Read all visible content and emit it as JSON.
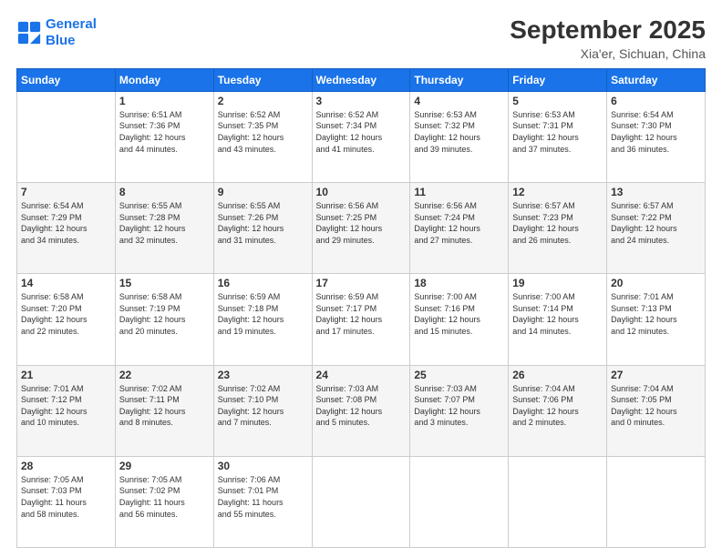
{
  "logo": {
    "line1": "General",
    "line2": "Blue"
  },
  "title": "September 2025",
  "subtitle": "Xia'er, Sichuan, China",
  "days_of_week": [
    "Sunday",
    "Monday",
    "Tuesday",
    "Wednesday",
    "Thursday",
    "Friday",
    "Saturday"
  ],
  "weeks": [
    [
      {
        "day": "",
        "info": ""
      },
      {
        "day": "1",
        "info": "Sunrise: 6:51 AM\nSunset: 7:36 PM\nDaylight: 12 hours\nand 44 minutes."
      },
      {
        "day": "2",
        "info": "Sunrise: 6:52 AM\nSunset: 7:35 PM\nDaylight: 12 hours\nand 43 minutes."
      },
      {
        "day": "3",
        "info": "Sunrise: 6:52 AM\nSunset: 7:34 PM\nDaylight: 12 hours\nand 41 minutes."
      },
      {
        "day": "4",
        "info": "Sunrise: 6:53 AM\nSunset: 7:32 PM\nDaylight: 12 hours\nand 39 minutes."
      },
      {
        "day": "5",
        "info": "Sunrise: 6:53 AM\nSunset: 7:31 PM\nDaylight: 12 hours\nand 37 minutes."
      },
      {
        "day": "6",
        "info": "Sunrise: 6:54 AM\nSunset: 7:30 PM\nDaylight: 12 hours\nand 36 minutes."
      }
    ],
    [
      {
        "day": "7",
        "info": "Sunrise: 6:54 AM\nSunset: 7:29 PM\nDaylight: 12 hours\nand 34 minutes."
      },
      {
        "day": "8",
        "info": "Sunrise: 6:55 AM\nSunset: 7:28 PM\nDaylight: 12 hours\nand 32 minutes."
      },
      {
        "day": "9",
        "info": "Sunrise: 6:55 AM\nSunset: 7:26 PM\nDaylight: 12 hours\nand 31 minutes."
      },
      {
        "day": "10",
        "info": "Sunrise: 6:56 AM\nSunset: 7:25 PM\nDaylight: 12 hours\nand 29 minutes."
      },
      {
        "day": "11",
        "info": "Sunrise: 6:56 AM\nSunset: 7:24 PM\nDaylight: 12 hours\nand 27 minutes."
      },
      {
        "day": "12",
        "info": "Sunrise: 6:57 AM\nSunset: 7:23 PM\nDaylight: 12 hours\nand 26 minutes."
      },
      {
        "day": "13",
        "info": "Sunrise: 6:57 AM\nSunset: 7:22 PM\nDaylight: 12 hours\nand 24 minutes."
      }
    ],
    [
      {
        "day": "14",
        "info": "Sunrise: 6:58 AM\nSunset: 7:20 PM\nDaylight: 12 hours\nand 22 minutes."
      },
      {
        "day": "15",
        "info": "Sunrise: 6:58 AM\nSunset: 7:19 PM\nDaylight: 12 hours\nand 20 minutes."
      },
      {
        "day": "16",
        "info": "Sunrise: 6:59 AM\nSunset: 7:18 PM\nDaylight: 12 hours\nand 19 minutes."
      },
      {
        "day": "17",
        "info": "Sunrise: 6:59 AM\nSunset: 7:17 PM\nDaylight: 12 hours\nand 17 minutes."
      },
      {
        "day": "18",
        "info": "Sunrise: 7:00 AM\nSunset: 7:16 PM\nDaylight: 12 hours\nand 15 minutes."
      },
      {
        "day": "19",
        "info": "Sunrise: 7:00 AM\nSunset: 7:14 PM\nDaylight: 12 hours\nand 14 minutes."
      },
      {
        "day": "20",
        "info": "Sunrise: 7:01 AM\nSunset: 7:13 PM\nDaylight: 12 hours\nand 12 minutes."
      }
    ],
    [
      {
        "day": "21",
        "info": "Sunrise: 7:01 AM\nSunset: 7:12 PM\nDaylight: 12 hours\nand 10 minutes."
      },
      {
        "day": "22",
        "info": "Sunrise: 7:02 AM\nSunset: 7:11 PM\nDaylight: 12 hours\nand 8 minutes."
      },
      {
        "day": "23",
        "info": "Sunrise: 7:02 AM\nSunset: 7:10 PM\nDaylight: 12 hours\nand 7 minutes."
      },
      {
        "day": "24",
        "info": "Sunrise: 7:03 AM\nSunset: 7:08 PM\nDaylight: 12 hours\nand 5 minutes."
      },
      {
        "day": "25",
        "info": "Sunrise: 7:03 AM\nSunset: 7:07 PM\nDaylight: 12 hours\nand 3 minutes."
      },
      {
        "day": "26",
        "info": "Sunrise: 7:04 AM\nSunset: 7:06 PM\nDaylight: 12 hours\nand 2 minutes."
      },
      {
        "day": "27",
        "info": "Sunrise: 7:04 AM\nSunset: 7:05 PM\nDaylight: 12 hours\nand 0 minutes."
      }
    ],
    [
      {
        "day": "28",
        "info": "Sunrise: 7:05 AM\nSunset: 7:03 PM\nDaylight: 11 hours\nand 58 minutes."
      },
      {
        "day": "29",
        "info": "Sunrise: 7:05 AM\nSunset: 7:02 PM\nDaylight: 11 hours\nand 56 minutes."
      },
      {
        "day": "30",
        "info": "Sunrise: 7:06 AM\nSunset: 7:01 PM\nDaylight: 11 hours\nand 55 minutes."
      },
      {
        "day": "",
        "info": ""
      },
      {
        "day": "",
        "info": ""
      },
      {
        "day": "",
        "info": ""
      },
      {
        "day": "",
        "info": ""
      }
    ]
  ]
}
